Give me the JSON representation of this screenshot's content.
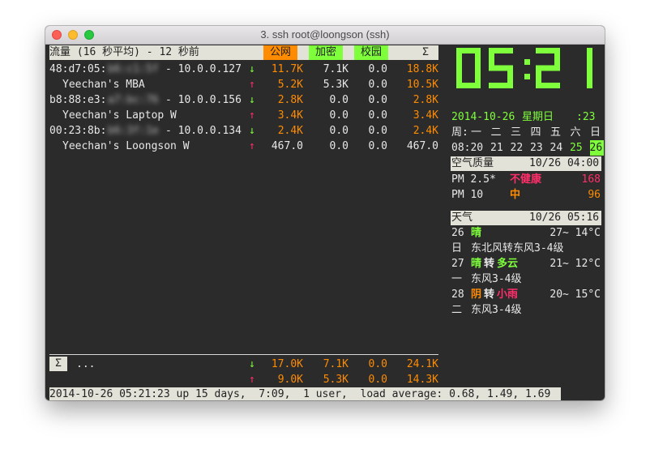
{
  "window": {
    "title": "3. ssh root@loongson (ssh)"
  },
  "traffic": {
    "header_label": "流量 (16 秒平均) - 12 秒前",
    "columns": [
      "公网",
      "加密",
      "校园",
      "Σ"
    ],
    "colors": {
      "orange": "#ff8c00",
      "green": "#7fff3c",
      "pink": "#ff2e6a"
    },
    "hosts": [
      {
        "mac_prefix": "48:d7:05:",
        "mac_hidden": "b6:c1:5f",
        "ip": "- 10.0.0.127",
        "name": "Yeechan's MBA",
        "down": [
          "11.7K",
          "7.1K",
          "0.0",
          "18.8K"
        ],
        "up": [
          "5.2K",
          "5.3K",
          "0.0",
          "10.5K"
        ]
      },
      {
        "mac_prefix": "b8:88:e3:",
        "mac_hidden": "a7:bc:76",
        "ip": "- 10.0.0.156",
        "name": "Yeechan's Laptop W",
        "down": [
          "2.8K",
          "0.0",
          "0.0",
          "2.8K"
        ],
        "up": [
          "3.4K",
          "0.0",
          "0.0",
          "3.4K"
        ]
      },
      {
        "mac_prefix": "00:23:8b:",
        "mac_hidden": "b6:3f:1e",
        "ip": "- 10.0.0.134",
        "name": "Yeechan's Loongson W",
        "down": [
          "2.4K",
          "0.0",
          "0.0",
          "2.4K"
        ],
        "up": [
          "467.0",
          "0.0",
          "0.0",
          "467.0"
        ]
      }
    ],
    "arrow_down": "↓",
    "arrow_up": "↑",
    "total": {
      "sigma": "Σ",
      "ellipsis": "...",
      "down": [
        "17.0K",
        "7.1K",
        "0.0",
        "24.1K"
      ],
      "up": [
        "9.0K",
        "5.3K",
        "0.0",
        "14.3K"
      ]
    }
  },
  "status_line": "2014-10-26 05:21:23 up 15 days,  7:09,  1 user,  load average: 0.68, 1.49, 1.69",
  "clock": {
    "time": "05:21",
    "date": "2014-10-26",
    "weekday": "星期日",
    "seconds": ":23"
  },
  "calendar": {
    "headers": [
      "周:",
      "一",
      "二",
      "三",
      "四",
      "五",
      "六",
      "日"
    ],
    "month_day": "08:20",
    "days": [
      "21",
      "22",
      "23",
      "24",
      "25",
      "26"
    ],
    "today": "26"
  },
  "air": {
    "title": "空气质量",
    "time": "10/26 04:00",
    "pm25_label": "PM 2.5*",
    "pm25_level": "不健康",
    "pm25_value": "168",
    "pm10_label": "PM 10",
    "pm10_level": "中",
    "pm10_value": "96"
  },
  "weather": {
    "title": "天气",
    "time": "10/26 05:16",
    "days": [
      {
        "day": "26",
        "cond": [
          {
            "t": "晴",
            "c": "g"
          }
        ],
        "temp": "27~ 14°C",
        "wd": "日",
        "wind": "东北风转东风3-4级"
      },
      {
        "day": "27",
        "cond": [
          {
            "t": "晴",
            "c": "g"
          },
          {
            "t": "转",
            "c": "w"
          },
          {
            "t": "多云",
            "c": "g"
          }
        ],
        "temp": "21~ 12°C",
        "wd": "一",
        "wind": "东风3-4级"
      },
      {
        "day": "28",
        "cond": [
          {
            "t": "阴",
            "c": "o"
          },
          {
            "t": "转",
            "c": "w"
          },
          {
            "t": "小雨",
            "c": "pk"
          }
        ],
        "temp": "20~ 15°C",
        "wd": "二",
        "wind": "东风3-4级"
      }
    ]
  }
}
